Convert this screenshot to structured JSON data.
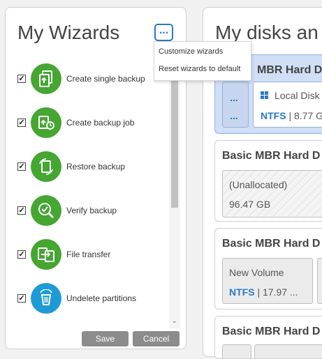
{
  "wizards": {
    "title": "My Wizards",
    "more_label": "...",
    "items": [
      {
        "label": "Create single backup",
        "icon": "single-backup-icon",
        "color": "#45a632"
      },
      {
        "label": "Create backup job",
        "icon": "backup-job-icon",
        "color": "#45a632"
      },
      {
        "label": "Restore backup",
        "icon": "restore-backup-icon",
        "color": "#45a632"
      },
      {
        "label": "Verify backup",
        "icon": "verify-backup-icon",
        "color": "#45a632"
      },
      {
        "label": "File transfer",
        "icon": "file-transfer-icon",
        "color": "#45a632"
      },
      {
        "label": "Undelete partitions",
        "icon": "undelete-partitions-icon",
        "color": "#1e9bd7"
      }
    ],
    "checkmark": "✓",
    "save_label": "Save",
    "cancel_label": "Cancel",
    "scroll_down_glyph": "⌄"
  },
  "context_menu": {
    "items": [
      "Customize wizards",
      "Reset wizards to default"
    ]
  },
  "disks": {
    "title": "My disks an",
    "cards": [
      {
        "title": "MBR Hard D",
        "selected": true,
        "partitions": [
          {
            "dots_top": "...",
            "dots_bottom": "..."
          },
          {
            "name": "Local Disk",
            "fs": "NTFS",
            "size": " | 8.77 G"
          }
        ]
      },
      {
        "title": "Basic MBR Hard D",
        "partitions": [
          {
            "name": "(Unallocated)",
            "size": "96.47 GB"
          }
        ]
      },
      {
        "title": "Basic MBR Hard D",
        "partitions": [
          {
            "name": "New Volume",
            "fs": "NTFS",
            "size": " | 17.97 ..."
          }
        ]
      },
      {
        "title": "Basic MBR Hard D"
      }
    ]
  },
  "colors": {
    "accent": "#2b78c5",
    "wizard_green": "#45a632",
    "wizard_blue": "#1e9bd7",
    "selected_card": "#d0dff6",
    "button_gray": "#8c8c8c"
  }
}
